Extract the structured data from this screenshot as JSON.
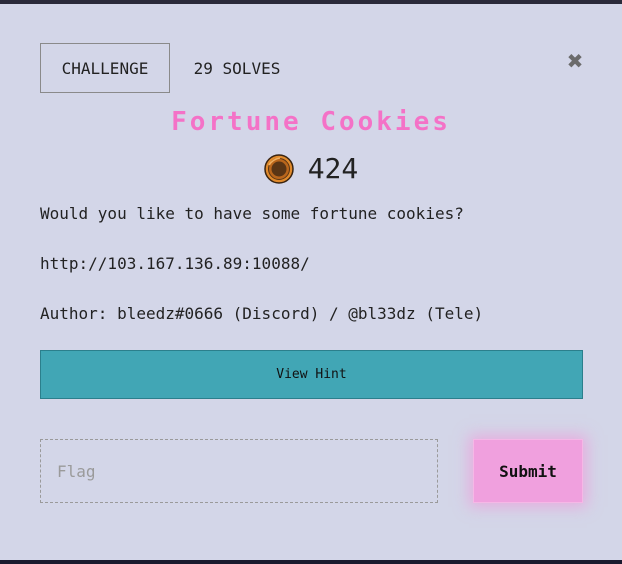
{
  "header": {
    "challenge_tab": "CHALLENGE",
    "solves_tab": "29 SOLVES"
  },
  "close_icon": "close-icon",
  "challenge": {
    "title": "Fortune Cookies",
    "points": "424",
    "points_icon": "coin-icon",
    "description": "Would you like to have some fortune cookies?",
    "url": "http://103.167.136.89:10088/",
    "author": "Author: bleedz#0666 (Discord) / @bl33dz (Tele)"
  },
  "hint": {
    "label": "View Hint"
  },
  "submission": {
    "placeholder": "Flag",
    "value": "",
    "submit_label": "Submit"
  },
  "colors": {
    "modal_bg": "#d3d6e8",
    "title": "#f472c7",
    "hint_bg": "#41a6b5",
    "submit_bg": "#f0a0de"
  }
}
